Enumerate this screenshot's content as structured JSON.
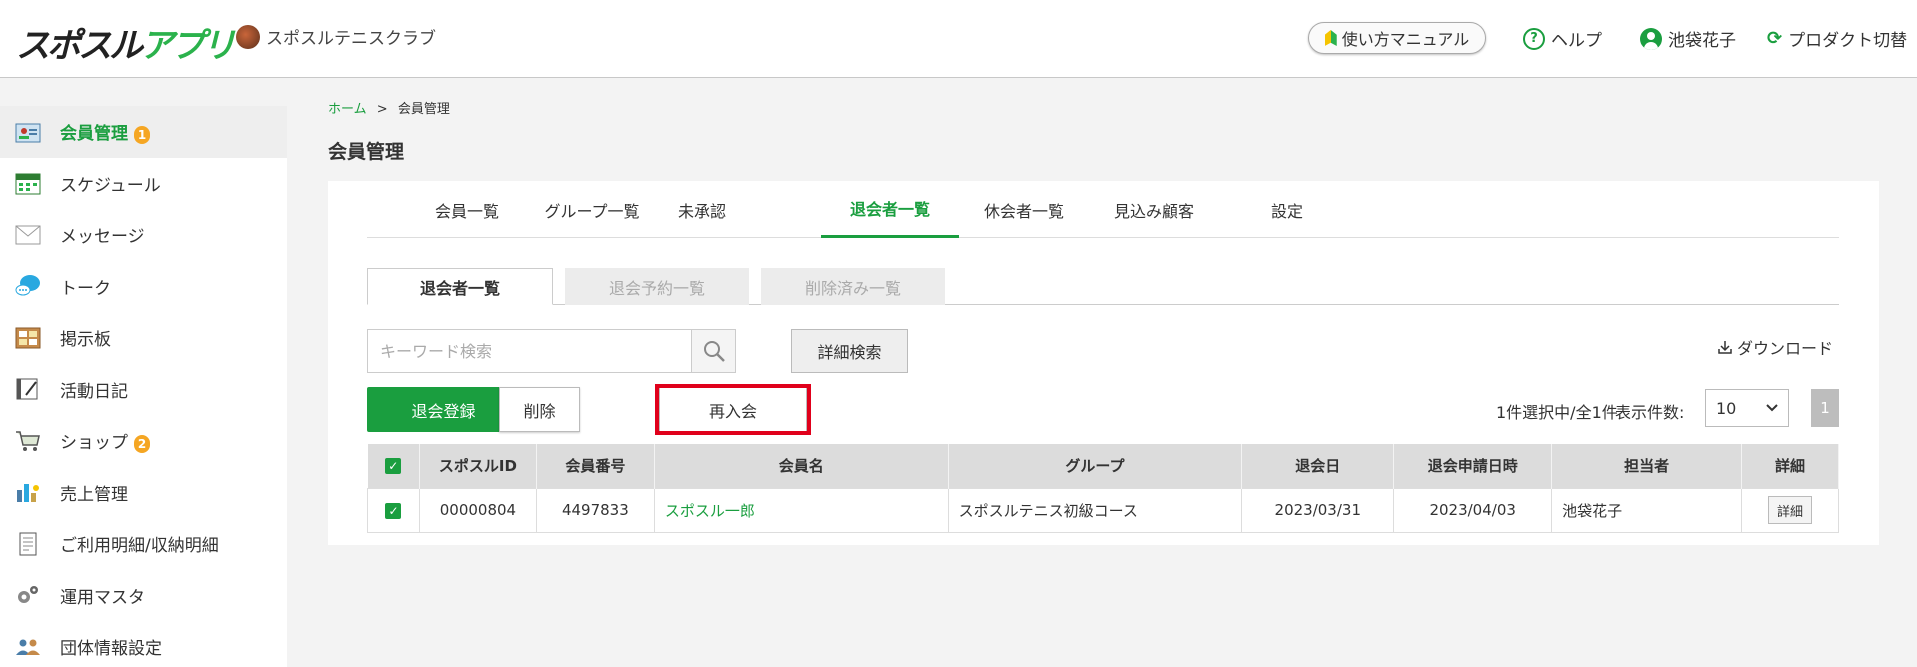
{
  "header": {
    "logo_part1": "スポスル",
    "logo_part2": "アプリ",
    "club_name": "スポスルテニスクラブ",
    "manual_label": "使い方マニュアル",
    "help_label": "ヘルプ",
    "user_name": "池袋花子",
    "product_switch_label": "プロダクト切替"
  },
  "sidebar": {
    "items": [
      {
        "label": "会員管理",
        "icon": "member-card-icon",
        "badge": "1",
        "active": true
      },
      {
        "label": "スケジュール",
        "icon": "calendar-icon"
      },
      {
        "label": "メッセージ",
        "icon": "envelope-icon"
      },
      {
        "label": "トーク",
        "icon": "speech-bubble-icon"
      },
      {
        "label": "掲示板",
        "icon": "bulletin-board-icon"
      },
      {
        "label": "活動日記",
        "icon": "diary-icon"
      },
      {
        "label": "ショップ",
        "icon": "cart-icon",
        "badge": "2"
      },
      {
        "label": "売上管理",
        "icon": "sales-chart-icon"
      },
      {
        "label": "ご利用明細/収納明細",
        "icon": "receipt-icon"
      },
      {
        "label": "運用マスタ",
        "icon": "gear-icon"
      },
      {
        "label": "団体情報設定",
        "icon": "group-icon"
      }
    ]
  },
  "breadcrumb": {
    "home": "ホーム",
    "separator": ">",
    "current": "会員管理"
  },
  "page_title": "会員管理",
  "tabs": [
    "会員一覧",
    "グループ一覧",
    "未承認",
    "退会者一覧",
    "休会者一覧",
    "見込み顧客",
    "設定"
  ],
  "active_tab": "退会者一覧",
  "subtabs": [
    "退会者一覧",
    "退会予約一覧",
    "削除済み一覧"
  ],
  "search": {
    "placeholder": "キーワード検索",
    "detail_label": "詳細検索"
  },
  "download_label": "ダウンロード",
  "actions": {
    "register": "退会登録",
    "delete": "削除",
    "rejoin": "再入会"
  },
  "count_text": "1件選択中/全1件",
  "perpage_label": "表示件数:",
  "perpage_value": "10",
  "page": "1",
  "table": {
    "headers": [
      "スポスルID",
      "会員番号",
      "会員名",
      "グループ",
      "退会日",
      "退会申請日時",
      "担当者",
      "詳細"
    ],
    "rows": [
      {
        "id": "00000804",
        "number": "4497833",
        "name": "スポスル一郎",
        "group": "スポスルテニス初級コース",
        "leave_date": "2023/03/31",
        "applied": "2023/04/03",
        "staff": "池袋花子",
        "detail": "詳細"
      }
    ]
  },
  "colors": {
    "brand_green": "#1a9e3f",
    "highlight_red": "#e0001b",
    "badge_orange": "#f5a623"
  }
}
